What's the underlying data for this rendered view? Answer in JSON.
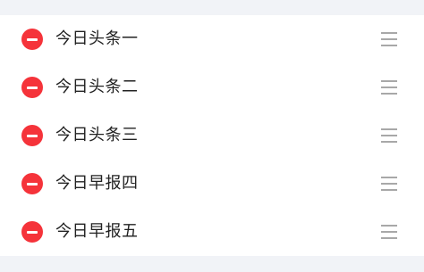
{
  "colors": {
    "background": "#f1f3f7",
    "list_background": "#ffffff",
    "delete_accent": "#f5333a",
    "handle": "#a8a8a8",
    "text": "#222222"
  },
  "icons": {
    "delete": "minus-circle-icon",
    "drag": "drag-handle-icon"
  },
  "list": {
    "items": [
      {
        "label": "今日头条一"
      },
      {
        "label": "今日头条二"
      },
      {
        "label": "今日头条三"
      },
      {
        "label": "今日早报四"
      },
      {
        "label": "今日早报五"
      }
    ]
  }
}
